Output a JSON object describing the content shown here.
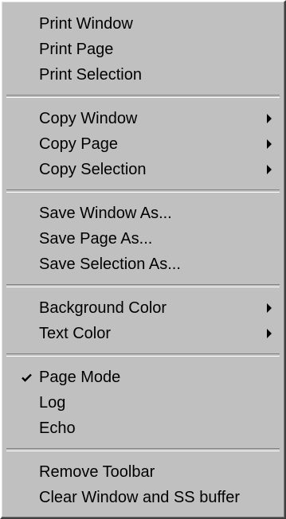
{
  "menu": {
    "groups": [
      {
        "items": [
          {
            "label": "Print Window",
            "submenu": false,
            "checked": false
          },
          {
            "label": "Print Page",
            "submenu": false,
            "checked": false
          },
          {
            "label": "Print Selection",
            "submenu": false,
            "checked": false
          }
        ]
      },
      {
        "items": [
          {
            "label": "Copy Window",
            "submenu": true,
            "checked": false
          },
          {
            "label": "Copy Page",
            "submenu": true,
            "checked": false
          },
          {
            "label": "Copy Selection",
            "submenu": true,
            "checked": false
          }
        ]
      },
      {
        "items": [
          {
            "label": "Save Window As...",
            "submenu": false,
            "checked": false
          },
          {
            "label": "Save Page As...",
            "submenu": false,
            "checked": false
          },
          {
            "label": "Save Selection As...",
            "submenu": false,
            "checked": false
          }
        ]
      },
      {
        "items": [
          {
            "label": "Background Color",
            "submenu": true,
            "checked": false
          },
          {
            "label": "Text Color",
            "submenu": true,
            "checked": false
          }
        ]
      },
      {
        "items": [
          {
            "label": "Page Mode",
            "submenu": false,
            "checked": true
          },
          {
            "label": "Log",
            "submenu": false,
            "checked": false
          },
          {
            "label": "Echo",
            "submenu": false,
            "checked": false
          }
        ]
      },
      {
        "items": [
          {
            "label": "Remove Toolbar",
            "submenu": false,
            "checked": false
          },
          {
            "label": "Clear Window and SS buffer",
            "submenu": false,
            "checked": false
          }
        ]
      }
    ]
  },
  "icons": {
    "check": "checkmark-icon",
    "submenu": "submenu-arrow-icon"
  },
  "colors": {
    "menu_bg": "#c0c0c0",
    "text": "#000000"
  }
}
